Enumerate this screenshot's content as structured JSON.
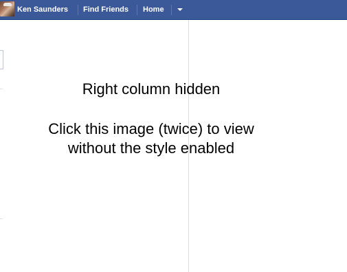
{
  "topbar": {
    "user_name": "Ken Saunders",
    "find_friends_label": "Find Friends",
    "home_label": "Home",
    "menu_icon": "chevron-down-icon",
    "background_color": "#3b5998"
  },
  "notice": {
    "line1": "Right column hidden",
    "line2": "Click this image (twice) to view",
    "line3": "without the style enabled"
  }
}
